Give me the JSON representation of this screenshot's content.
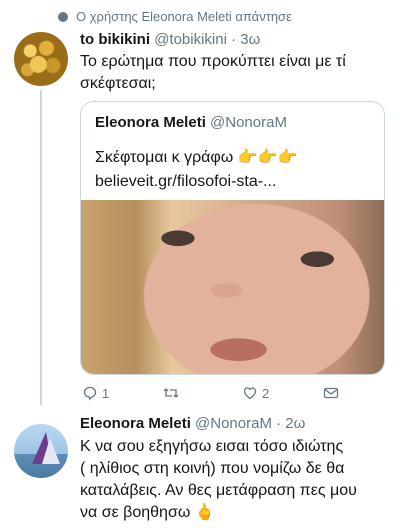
{
  "context": {
    "icon": "reply-context-icon",
    "text": "Ο χρήστης Eleonora Meleti απάντησε"
  },
  "tweet1": {
    "avatar": "gold-coins-avatar",
    "name": "to bikikini",
    "handle": "@tobikikini",
    "time": "· 3ω",
    "text_line1": "Το ερώτημα που προκύπτει είναι με τί",
    "text_line2": "σκέφτεσαι;",
    "quoted": {
      "name": "Eleonora Meleti",
      "handle": "@NonoraM",
      "text": "Σκέφτομαι κ γράφω",
      "emoji": "👉👉👉",
      "link": "believeit.gr/filosofoi-sta-..."
    },
    "actions": {
      "reply_count": "1",
      "retweet_count": "",
      "like_count": "2"
    }
  },
  "tweet2": {
    "avatar": "windsurf-avatar",
    "name": "Eleonora Meleti",
    "handle": "@NonoraM",
    "time": "· 2ω",
    "text_line1": "Κ να σου εξηγήσω εισαι τόσο ιδιώτης",
    "text_line2": "( ηλίθιος στη κοινή) που νομίζω δε θα",
    "text_line3": "καταλάβεις. Αν θες μετάφραση πες μου",
    "text_line4": "να σε βοηθησω",
    "emoji": "🖕"
  }
}
